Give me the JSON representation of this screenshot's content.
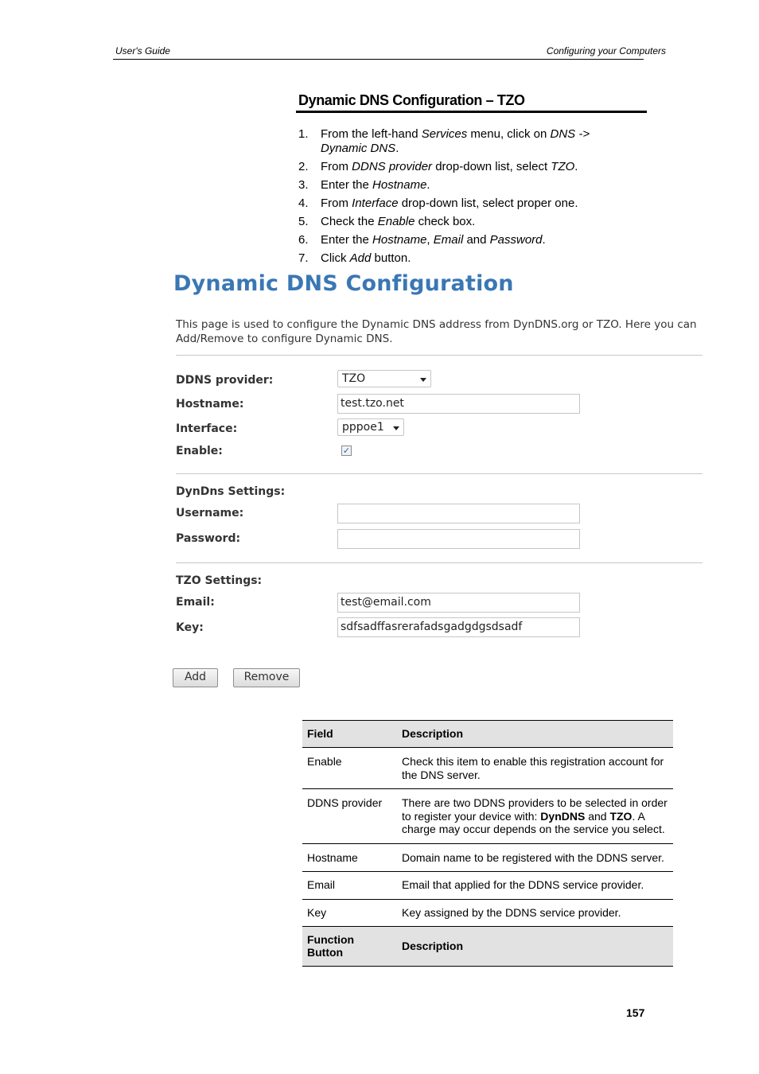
{
  "header": {
    "left": "User's Guide",
    "right": "Configuring your Computers"
  },
  "section_title": "Dynamic DNS Configuration – TZO",
  "steps": [
    {
      "num": "1.",
      "a": "From the left-hand ",
      "b": "Services",
      "c": " menu, click on ",
      "d": "DNS -> Dynamic DNS",
      "e": "."
    },
    {
      "num": "2.",
      "a": "From ",
      "b": "DDNS provider",
      "c": " drop-down list, select ",
      "d": "TZO",
      "e": "."
    },
    {
      "num": "3.",
      "a": "Enter the ",
      "b": "Hostname",
      "c": "."
    },
    {
      "num": "4.",
      "a": "From ",
      "b": "Interface",
      "c": " drop-down list, select proper one."
    },
    {
      "num": "5.",
      "a": "Check the ",
      "b": "Enable",
      "c": " check box."
    },
    {
      "num": "6.",
      "a": "Enter the ",
      "b": "Hostname",
      "c": ", ",
      "d": "Email",
      "e": " and ",
      "f": "Password",
      "g": "."
    },
    {
      "num": "7.",
      "a": "Click ",
      "b": "Add",
      "c": " button."
    }
  ],
  "ui": {
    "title": "Dynamic DNS Configuration",
    "description": "This page is used to configure the Dynamic DNS address from DynDNS.org or TZO. Here you can Add/Remove to configure Dynamic DNS.",
    "ddns_provider_label": "DDNS provider:",
    "ddns_provider_value": "TZO",
    "hostname_label": "Hostname:",
    "hostname_value": "test.tzo.net",
    "interface_label": "Interface:",
    "interface_value": "pppoe1",
    "enable_label": "Enable:",
    "enable_checked": true,
    "dyndns_settings_label": "DynDns Settings:",
    "username_label": "Username:",
    "username_value": "",
    "password_label": "Password:",
    "password_value": "",
    "tzo_settings_label": "TZO Settings:",
    "email_label": "Email:",
    "email_value": "test@email.com",
    "key_label": "Key:",
    "key_value": "sdfsadffasrerafadsgadgdgsdsadf",
    "add_button": "Add",
    "remove_button": "Remove",
    "accent_color": "#3a77b4"
  },
  "table": {
    "header": {
      "field": "Field",
      "description": "Description"
    },
    "rows": [
      {
        "field": "Enable",
        "description": "Check this item to enable this registration account for the DNS server."
      },
      {
        "field": "DDNS provider",
        "d1": "There are two DDNS providers to be selected in order to register your device with: ",
        "b1": "DynDNS",
        "d2": " and ",
        "b2": "TZO",
        "d3": ". A charge may occur depends on the service you select."
      },
      {
        "field": "Hostname",
        "description": "Domain name to be registered with the DDNS server."
      },
      {
        "field": "Email",
        "description": "Email that applied for the DDNS service provider."
      },
      {
        "field": "Key",
        "description": "Key assigned by the DDNS service provider."
      }
    ],
    "footer": {
      "field": "Function Button",
      "description": "Description"
    }
  },
  "page_number": "157"
}
